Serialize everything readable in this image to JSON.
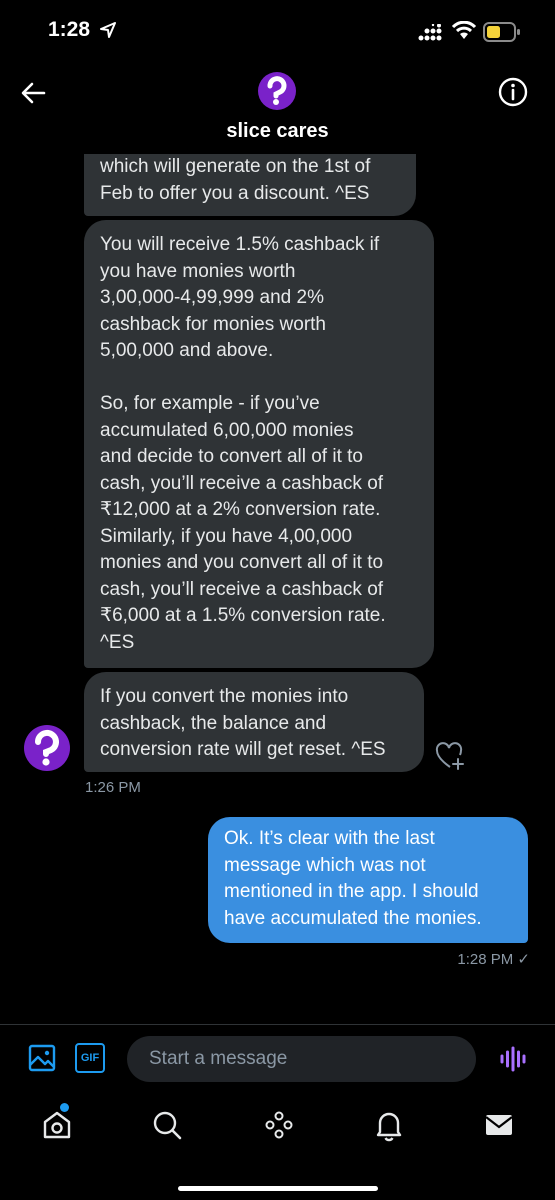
{
  "status_bar": {
    "time": "1:28"
  },
  "header": {
    "title": "slice cares"
  },
  "messages": {
    "received_1": "which will generate on the 1st of\nFeb to offer you a discount. ^ES",
    "received_2": "You will receive 1.5% cashback if\nyou have monies worth\n3,00,000-4,99,999 and 2%\ncashback for monies worth\n5,00,000 and above.\n\nSo, for example - if you’ve\naccumulated 6,00,000 monies\nand decide to convert all of it to\ncash, you’ll receive a cashback of\n₹12,000 at a 2% conversion rate.\nSimilarly, if you have 4,00,000\nmonies and you convert all of it to\ncash, you’ll receive a cashback of\n₹6,000 at a 1.5% conversion rate.\n^ES",
    "received_3": "If you convert the monies into\ncashback, the balance and\nconversion rate will get reset. ^ES",
    "received_time": "1:26 PM",
    "sent_1": "Ok. It’s clear with the last message which was not mentioned in the app.  I should have accumulated the monies.",
    "sent_time": "1:28 PM ✓"
  },
  "composer": {
    "gif_label": "GIF",
    "placeholder": "Start a message"
  },
  "icons": {
    "back": "arrow-left-icon",
    "info": "info-icon",
    "react": "heart-plus-icon",
    "image": "image-icon",
    "voice": "voice-wave-icon",
    "home": "home-icon",
    "search": "search-icon",
    "spaces": "spaces-icon",
    "notifications": "bell-icon",
    "messages": "envelope-icon"
  },
  "colors": {
    "accent": "#1d9bf0",
    "sent_bubble": "#3a8fe0",
    "received_bubble": "#2f3336",
    "avatar": "#7a22c9",
    "voice": "#a970ff"
  }
}
